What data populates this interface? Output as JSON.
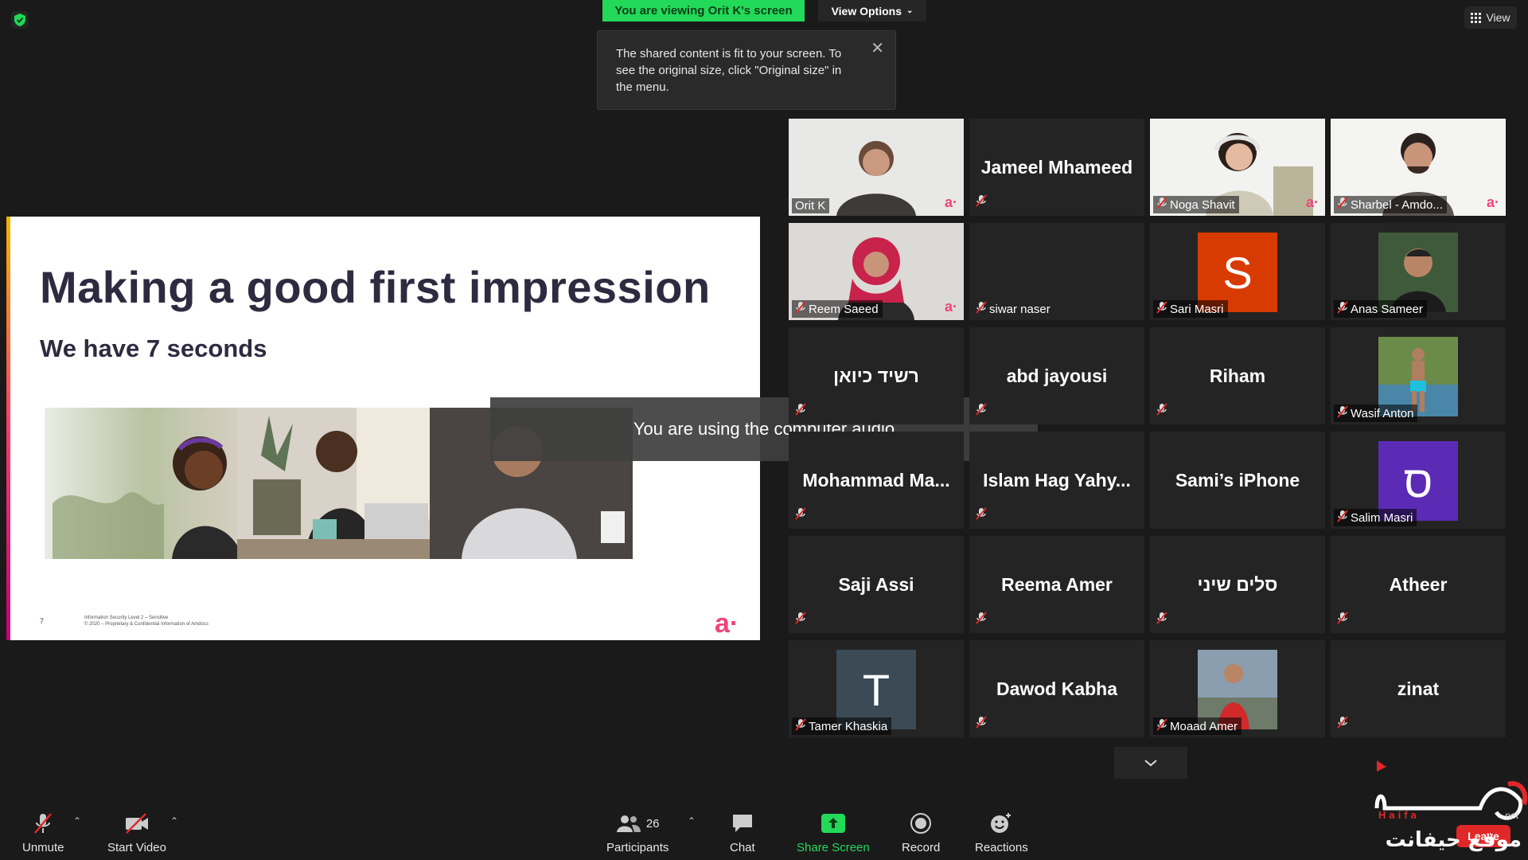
{
  "top": {
    "banner": "You are viewing Orit K's screen",
    "view_options": "View Options",
    "tooltip": "The shared content is fit to your screen. To see the original size, click \"Original size\" in the menu.",
    "view": "View"
  },
  "slide": {
    "title": "Making a good first impression",
    "subtitle": "We have 7 seconds",
    "page_number": "7",
    "footer_line1": "Information Security Level 2 – Sensitive",
    "footer_line2": "© 2020 – Proprietary & Confidential Information of Amdocs",
    "logo": "a·"
  },
  "toast": "You are using the computer audio",
  "participants": [
    {
      "name": "Orit K",
      "kind": "video",
      "active": true,
      "muted": false
    },
    {
      "name": "Jameel Mhameed",
      "kind": "name",
      "muted": true
    },
    {
      "name": "Noga Shavit",
      "kind": "video",
      "muted": true
    },
    {
      "name": "Sharbel - Amdo...",
      "kind": "video",
      "muted": true
    },
    {
      "name": "Reem Saeed",
      "kind": "video",
      "muted": true
    },
    {
      "name": "siwar naser",
      "kind": "blank",
      "muted": true
    },
    {
      "name": "Sari Masri",
      "kind": "avatar",
      "letter": "S",
      "color": "#d83b01",
      "muted": true
    },
    {
      "name": "Anas Sameer",
      "kind": "photo",
      "muted": true
    },
    {
      "name": "רשיד כיואן",
      "kind": "name",
      "muted": true
    },
    {
      "name": "abd jayousi",
      "kind": "name",
      "muted": true
    },
    {
      "name": "Riham",
      "kind": "name",
      "muted": true
    },
    {
      "name": "Wasif Anton",
      "kind": "photo",
      "muted": true
    },
    {
      "name": "Mohammad  Ma...",
      "kind": "name",
      "muted": true
    },
    {
      "name": "Islam  Hag  Yahy...",
      "kind": "name",
      "muted": true
    },
    {
      "name": "Sami’s iPhone",
      "kind": "name",
      "muted": false
    },
    {
      "name": "Salim Masri",
      "kind": "avatar",
      "letter": "ס",
      "color": "#5b2bb5",
      "muted": true
    },
    {
      "name": "Saji Assi",
      "kind": "name",
      "muted": true
    },
    {
      "name": "Reema Amer",
      "kind": "name",
      "muted": true
    },
    {
      "name": "סלים שיני",
      "kind": "name",
      "muted": true
    },
    {
      "name": "Atheer",
      "kind": "name",
      "muted": true
    },
    {
      "name": "Tamer Khaskia",
      "kind": "avatar",
      "letter": "T",
      "color": "#3b4a55",
      "muted": true
    },
    {
      "name": "Dawod Kabha",
      "kind": "name",
      "muted": true
    },
    {
      "name": "Moaad Amer",
      "kind": "photo",
      "muted": true
    },
    {
      "name": "zinat",
      "kind": "name",
      "muted": true
    }
  ],
  "toolbar": {
    "unmute": "Unmute",
    "start_video": "Start Video",
    "participants": "Participants",
    "participants_count": "26",
    "chat": "Chat",
    "share_screen": "Share Screen",
    "record": "Record",
    "reactions": "Reactions",
    "leave": "Leave"
  },
  "watermark": {
    "line1": "Haifa",
    "line2": ".net",
    "arabic": "موقع حيفانت"
  },
  "colors": {
    "banner_green": "#23d959",
    "share_green": "#23d959",
    "active_border": "#d9f05a",
    "mute_red": "#e02828",
    "brand_pink": "#f0447a"
  }
}
